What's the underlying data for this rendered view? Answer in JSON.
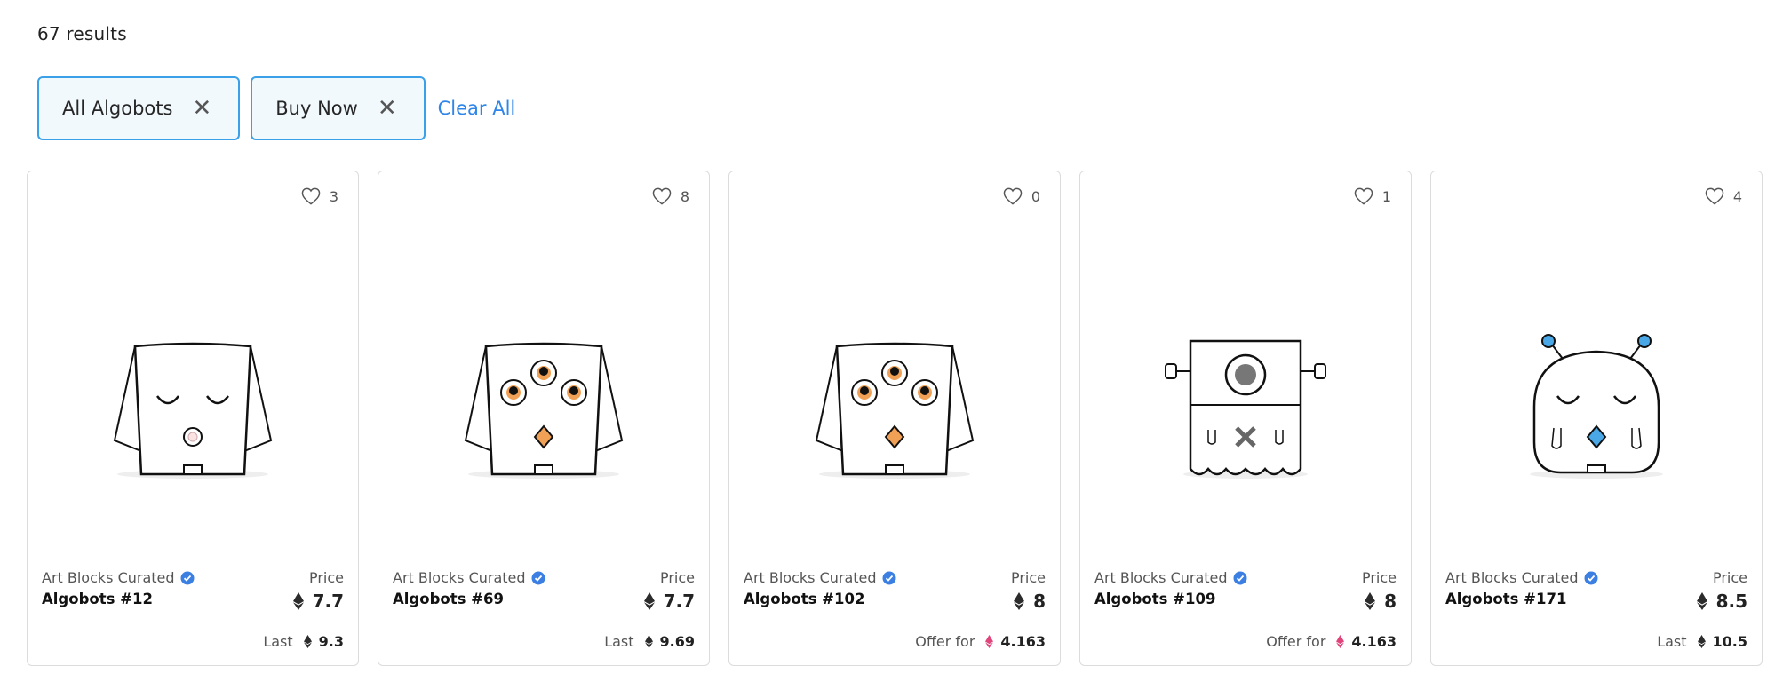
{
  "results_text": "67 results",
  "filters": {
    "chips": [
      {
        "label": "All Algobots",
        "remove_icon": "close-icon"
      },
      {
        "label": "Buy Now",
        "remove_icon": "close-icon"
      }
    ],
    "clear_all": "Clear All"
  },
  "colors": {
    "accent": "#2f86e8",
    "chip_border": "#3aa0e8",
    "verified": "#3b7fe3",
    "eth_dark": "#2b2b2b",
    "eth_pink": "#e0447a",
    "orange_diamond": "#f1a155",
    "blue_diamond": "#4aa8e6"
  },
  "cards": [
    {
      "likes": "3",
      "maker": "Art Blocks Curated",
      "name": "Algobots #12",
      "price_label": "Price",
      "price": "7.7",
      "foot_label": "Last",
      "foot_value": "9.3",
      "foot_icon": "eth-dark-icon",
      "art": "sleepy-box-bot"
    },
    {
      "likes": "8",
      "maker": "Art Blocks Curated",
      "name": "Algobots #69",
      "price_label": "Price",
      "price": "7.7",
      "foot_label": "Last",
      "foot_value": "9.69",
      "foot_icon": "eth-dark-icon",
      "art": "three-eyed-box-bot"
    },
    {
      "likes": "0",
      "maker": "Art Blocks Curated",
      "name": "Algobots #102",
      "price_label": "Price",
      "price": "8",
      "foot_label": "Offer for",
      "foot_value": "4.163",
      "foot_icon": "eth-pink-icon",
      "art": "three-eyed-box-bot"
    },
    {
      "likes": "1",
      "maker": "Art Blocks Curated",
      "name": "Algobots #109",
      "price_label": "Price",
      "price": "8",
      "foot_label": "Offer for",
      "foot_value": "4.163",
      "foot_icon": "eth-pink-icon",
      "art": "cyclops-ghost-bot"
    },
    {
      "likes": "4",
      "maker": "Art Blocks Curated",
      "name": "Algobots #171",
      "price_label": "Price",
      "price": "8.5",
      "foot_label": "Last",
      "foot_value": "10.5",
      "foot_icon": "eth-dark-icon",
      "art": "antenna-blob-bot"
    }
  ]
}
